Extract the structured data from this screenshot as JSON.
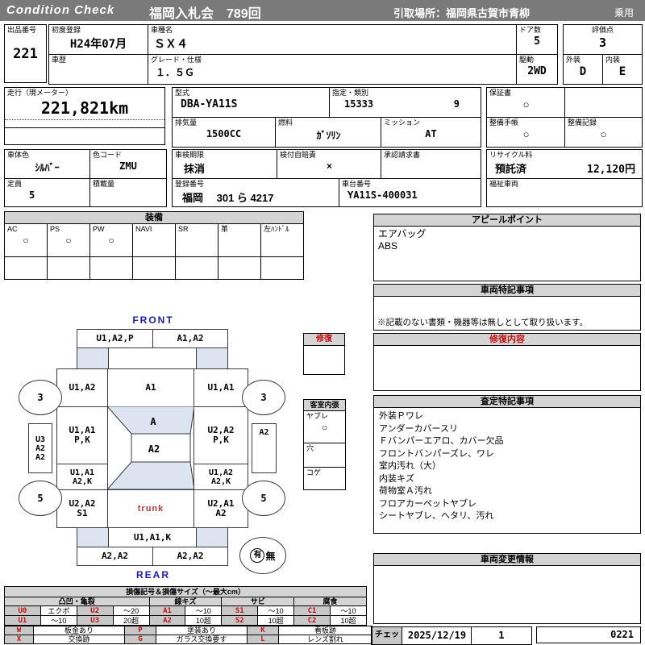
{
  "colors": {
    "bar_gray": "#7a7a7a",
    "section_gray": "#d4d4d4",
    "light_blue": "#dbe4f0",
    "red": "#c41111",
    "blue": "#1a1abe"
  },
  "header": {
    "brand": "Condition  Check",
    "auction": "福岡入札会　789回",
    "pickup": "引取場所：福岡県古賀市青柳",
    "category": "乗用"
  },
  "info": {
    "lot": {
      "label": "出品番号",
      "value": "221"
    },
    "first_reg": {
      "label": "初度登録",
      "value": "H24年07月"
    },
    "history": {
      "label": "車歴",
      "value": ""
    },
    "model": {
      "label": "車種名",
      "value": "ＳＸ４"
    },
    "grade": {
      "label": "グレード・仕様",
      "value": "１．５Ｇ"
    },
    "doors": {
      "label": "ドア数",
      "value": "5"
    },
    "drive": {
      "label": "駆動",
      "value": "2WD"
    },
    "score": {
      "label": "評価点",
      "value": "3"
    },
    "exterior": {
      "label": "外装",
      "value": "D"
    },
    "interior": {
      "label": "内装",
      "value": "E"
    },
    "mileage": {
      "label": "走行（現メーター）",
      "value": "221,821km"
    },
    "model_code": {
      "label": "型式",
      "value": "DBA-YA11S"
    },
    "type_class": {
      "label": "指定・類別",
      "type_no": "15333",
      "class_no": "9"
    },
    "displacement": {
      "label": "排気量",
      "value": "1500CC"
    },
    "fuel": {
      "label": "燃料",
      "value": "ｶﾞｿﾘﾝ"
    },
    "mission": {
      "label": "ミッション",
      "value": "AT"
    },
    "warranty": {
      "label": "保証書",
      "value": "○"
    },
    "maint_book": {
      "label": "整備手帳",
      "value": "○"
    },
    "maint_record": {
      "label": "整備記録",
      "value": "○"
    },
    "body_color": {
      "label": "車体色",
      "value": "ｼﾙﾊﾞｰ"
    },
    "color_code": {
      "label": "色コード",
      "value": "ZMU"
    },
    "capacity": {
      "label": "定員",
      "value": "5"
    },
    "load": {
      "label": "積載量",
      "value": ""
    },
    "inspection": {
      "label": "車検期限",
      "value": "抹消"
    },
    "jibai": {
      "label": "検付自賠責",
      "value": "×"
    },
    "approval": {
      "label": "承認請求書",
      "value": ""
    },
    "reg_no": {
      "label": "登録番号",
      "value": "福岡　 301 ら 4217"
    },
    "chassis": {
      "label": "車台番号",
      "value": "YA11S-400031"
    },
    "recycle": {
      "label": "リサイクル料",
      "status": "預託済",
      "fee": "12,120円"
    },
    "welfare": {
      "label": "福祉車両",
      "value": ""
    }
  },
  "equipment": {
    "title": "装備",
    "items": [
      {
        "label": "AC",
        "mark": "○"
      },
      {
        "label": "PS",
        "mark": "○"
      },
      {
        "label": "PW",
        "mark": "○"
      },
      {
        "label": "NAVI",
        "mark": ""
      },
      {
        "label": "SR",
        "mark": ""
      },
      {
        "label": "革",
        "mark": ""
      },
      {
        "label": "左ﾊﾝﾄﾞﾙ",
        "mark": ""
      }
    ]
  },
  "appeal": {
    "title": "アピールポイント",
    "line1": "エアバッグ",
    "line2": "ABS"
  },
  "special_notes": {
    "title": "車両特記事項",
    "note": "※記載のない書類・機器等は無しとして取り扱います。"
  },
  "repair": {
    "panel_title": "修復内容",
    "box_title": "修復"
  },
  "cabin": {
    "title": "客室内張",
    "rows": [
      {
        "label": "ヤブレ",
        "mark": "○"
      },
      {
        "label": "穴",
        "mark": ""
      },
      {
        "label": "コゲ",
        "mark": ""
      }
    ]
  },
  "assessment": {
    "title": "査定特記事項",
    "lines": [
      "外装Ｐワレ",
      "アンダーカバースリ",
      "Ｆバンパーエアロ、カバー欠品",
      "フロントバンパーズレ、ワレ",
      "室内汚れ（大）",
      "内装キズ",
      "荷物室Ａ汚れ",
      "フロアカーペットヤブレ",
      "シートヤブレ、ヘタリ、汚れ"
    ]
  },
  "change_info": {
    "title": "車両変更情報"
  },
  "check": {
    "label": "チェック",
    "date": "2025/12/19",
    "num": "1",
    "code": "0221"
  },
  "diagram": {
    "front_label": "FRONT",
    "rear_label": "REAR",
    "trunk_label": "trunk",
    "front_bumper": [
      "U1,A2,P",
      "A1,A2"
    ],
    "front_fender_left": "U1,A2",
    "hood": "A1",
    "front_fender_right": "U1,A1",
    "windshield": "A",
    "roof": "A2",
    "door_front_left": [
      "U1,A1",
      "P,K"
    ],
    "door_front_right": [
      "U2,A2",
      "P,K"
    ],
    "door_rear_left": [
      "U1,A1",
      "A2,K"
    ],
    "door_rear_right": [
      "U1,A2",
      "A2,K"
    ],
    "sill_left": [
      "U3",
      "A2",
      "A2"
    ],
    "sill_right": "A2",
    "fender_rear_left": [
      "U2,A2",
      "S1"
    ],
    "fender_rear_right": [
      "U2,A1",
      "A2"
    ],
    "rear_panel": "U1,A1,K",
    "rear_bumper": [
      "A2,A2",
      "A2,A2"
    ],
    "tire_front": "3",
    "tire_rear": "5",
    "spare_yes": "有",
    "spare_no": "無"
  },
  "legend": {
    "title": "損傷記号＆損傷サイズ（～最大cm）",
    "groups": [
      "凸凹・亀裂",
      "線キズ",
      "サビ",
      "腐食"
    ],
    "row1": [
      "U0",
      "エクボ",
      "U2",
      "～20",
      "A1",
      "～10",
      "S1",
      "～10",
      "C1",
      "～10"
    ],
    "row2": [
      "U1",
      "～10",
      "U3",
      "20超",
      "A2",
      "10超",
      "S2",
      "10超",
      "C2",
      "10超"
    ],
    "marks_row1": [
      "W",
      "板金あり",
      "P",
      "塗装あり",
      "K",
      "看板跡"
    ],
    "marks_row2": [
      "X",
      "交換跡",
      "G",
      "ガラス交換要す",
      "L",
      "レンズ割れ"
    ]
  }
}
